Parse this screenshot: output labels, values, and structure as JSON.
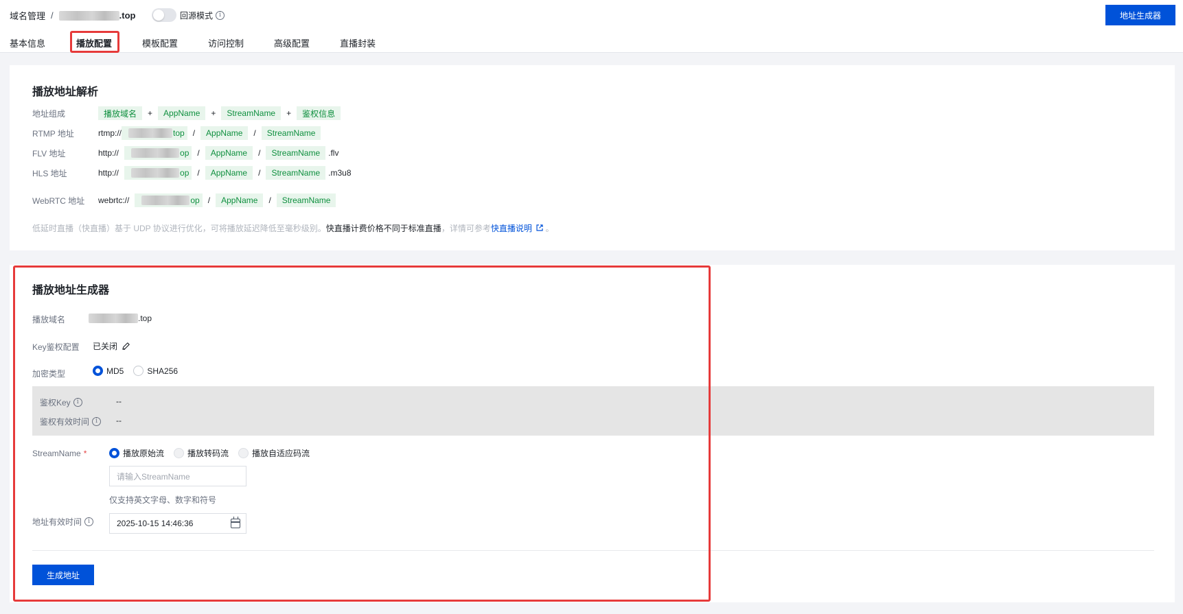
{
  "header": {
    "breadcrumb_root": "域名管理",
    "breadcrumb_sep": "/",
    "domain_suffix": ".top",
    "toggle_label": "回源模式",
    "action_button": "地址生成器"
  },
  "tabs": [
    {
      "label": "基本信息"
    },
    {
      "label": "播放配置",
      "active": true
    },
    {
      "label": "模板配置"
    },
    {
      "label": "访问控制"
    },
    {
      "label": "高级配置"
    },
    {
      "label": "直播封装"
    }
  ],
  "parse": {
    "title": "播放地址解析",
    "compose_label": "地址组成",
    "compose_tags": [
      "播放域名",
      "AppName",
      "StreamName",
      "鉴权信息"
    ],
    "plus": "+",
    "slash": "/",
    "rtmp": {
      "label": "RTMP 地址",
      "prefix": "rtmp://",
      "host_suffix": "top",
      "app": "AppName",
      "stream": "StreamName",
      "tail": ""
    },
    "flv": {
      "label": "FLV 地址",
      "prefix": "http://",
      "host_suffix": "op",
      "app": "AppName",
      "stream": "StreamName",
      "tail": ".flv"
    },
    "hls": {
      "label": "HLS 地址",
      "prefix": "http://",
      "host_suffix": "op",
      "app": "AppName",
      "stream": "StreamName",
      "tail": ".m3u8"
    },
    "webrtc": {
      "label": "WebRTC 地址",
      "prefix": "webrtc://",
      "host_suffix": "op",
      "app": "AppName",
      "stream": "StreamName",
      "tail": ""
    },
    "note_gray": "低延时直播（快直播）基于 UDP 协议进行优化，可将播放延迟降低至毫秒级别。",
    "note_strong": "快直播计费价格不同于标准直播",
    "note_gray2": "，详情可参考",
    "note_link": "快直播说明",
    "note_end": "。"
  },
  "generator": {
    "title": "播放地址生成器",
    "domain_label": "播放域名",
    "domain_suffix": ".top",
    "key_label": "Key鉴权配置",
    "key_value": "已关闭",
    "encrypt_label": "加密类型",
    "encrypt_options": [
      "MD5",
      "SHA256"
    ],
    "auth_key_label": "鉴权Key",
    "auth_key_value": "--",
    "auth_time_label": "鉴权有效时间",
    "auth_time_value": "--",
    "stream_label": "StreamName",
    "required_mark": "*",
    "stream_options": [
      "播放原始流",
      "播放转码流",
      "播放自适应码流"
    ],
    "stream_placeholder": "请输入StreamName",
    "stream_hint": "仅支持英文字母、数字和符号",
    "expire_label": "地址有效时间",
    "expire_value": "2025-10-15 14:46:36",
    "generate_button": "生成地址"
  },
  "colors": {
    "primary": "#0052d9",
    "tag_bg": "#e8f5ec",
    "tag_text": "#0e8f3e",
    "highlight": "#e63a3a"
  }
}
